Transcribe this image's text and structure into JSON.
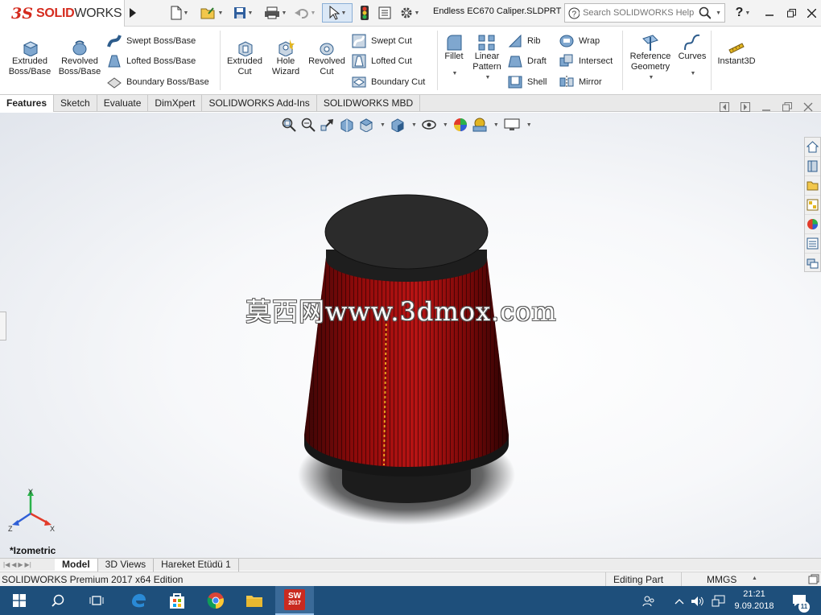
{
  "app": {
    "logo_ds": "3S",
    "logo_text_a": "SOLID",
    "logo_text_b": "WORKS",
    "file_title": "Endless EC670 Caliper.SLDPRT"
  },
  "search": {
    "placeholder": "Search SOLIDWORKS Help"
  },
  "help": {
    "label": "?"
  },
  "ribbon": {
    "extruded_boss": "Extruded\nBoss/Base",
    "revolved_boss": "Revolved\nBoss/Base",
    "swept_boss": "Swept Boss/Base",
    "lofted_boss": "Lofted Boss/Base",
    "boundary_boss": "Boundary Boss/Base",
    "extruded_cut": "Extruded\nCut",
    "hole_wizard": "Hole\nWizard",
    "revolved_cut": "Revolved\nCut",
    "swept_cut": "Swept Cut",
    "lofted_cut": "Lofted Cut",
    "boundary_cut": "Boundary Cut",
    "fillet": "Fillet",
    "linear_pattern": "Linear\nPattern",
    "rib": "Rib",
    "draft": "Draft",
    "shell": "Shell",
    "wrap": "Wrap",
    "intersect": "Intersect",
    "mirror": "Mirror",
    "reference_geometry": "Reference\nGeometry",
    "curves": "Curves",
    "instant3d": "Instant3D"
  },
  "tabs": [
    "Features",
    "Sketch",
    "Evaluate",
    "DimXpert",
    "SOLIDWORKS Add-Ins",
    "SOLIDWORKS MBD"
  ],
  "viewport": {
    "view_name": "*Izometric",
    "watermark": "莫西网www.3dmox.com",
    "axis_x": "X",
    "axis_y": "Y",
    "axis_z": "Z"
  },
  "bottom_tabs": [
    "Model",
    "3D Views",
    "Hareket Etüdü 1"
  ],
  "status": {
    "edition": "SOLIDWORKS Premium 2017 x64 Edition",
    "mode": "Editing Part",
    "units": "MMGS"
  },
  "taskbar": {
    "time": "21:21",
    "date": "9.09.2018",
    "notif_count": "11",
    "sw_badge": "2017"
  },
  "colors": {
    "filter_red": "#8e0a0a",
    "cap_black": "#2b2b2b",
    "taskbar": "#1e4f7b",
    "brand_red": "#d52b1e"
  }
}
